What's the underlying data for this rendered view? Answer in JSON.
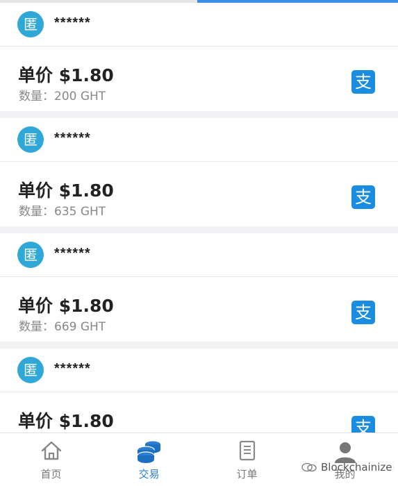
{
  "listings": [
    {
      "avatar_char": "匿",
      "seller": "******",
      "price": "单价 $1.80",
      "quantity": "数量：200 GHT",
      "pay_char": "支"
    },
    {
      "avatar_char": "匿",
      "seller": "******",
      "price": "单价 $1.80",
      "quantity": "数量：635 GHT",
      "pay_char": "支"
    },
    {
      "avatar_char": "匿",
      "seller": "******",
      "price": "单价 $1.80",
      "quantity": "数量：669 GHT",
      "pay_char": "支"
    },
    {
      "avatar_char": "匿",
      "seller": "******",
      "price": "单价 $1.80",
      "quantity": "",
      "pay_char": "支"
    }
  ],
  "tabs": [
    {
      "label": "首页",
      "icon": "home-icon"
    },
    {
      "label": "交易",
      "icon": "coins-icon"
    },
    {
      "label": "订单",
      "icon": "document-icon"
    },
    {
      "label": "我的",
      "icon": "person-icon"
    }
  ],
  "watermark": "Blockchainize",
  "colors": {
    "accent": "#2a7fd4",
    "avatar_bg": "#2fa8d8",
    "alipay_blue": "#1a8de0"
  }
}
